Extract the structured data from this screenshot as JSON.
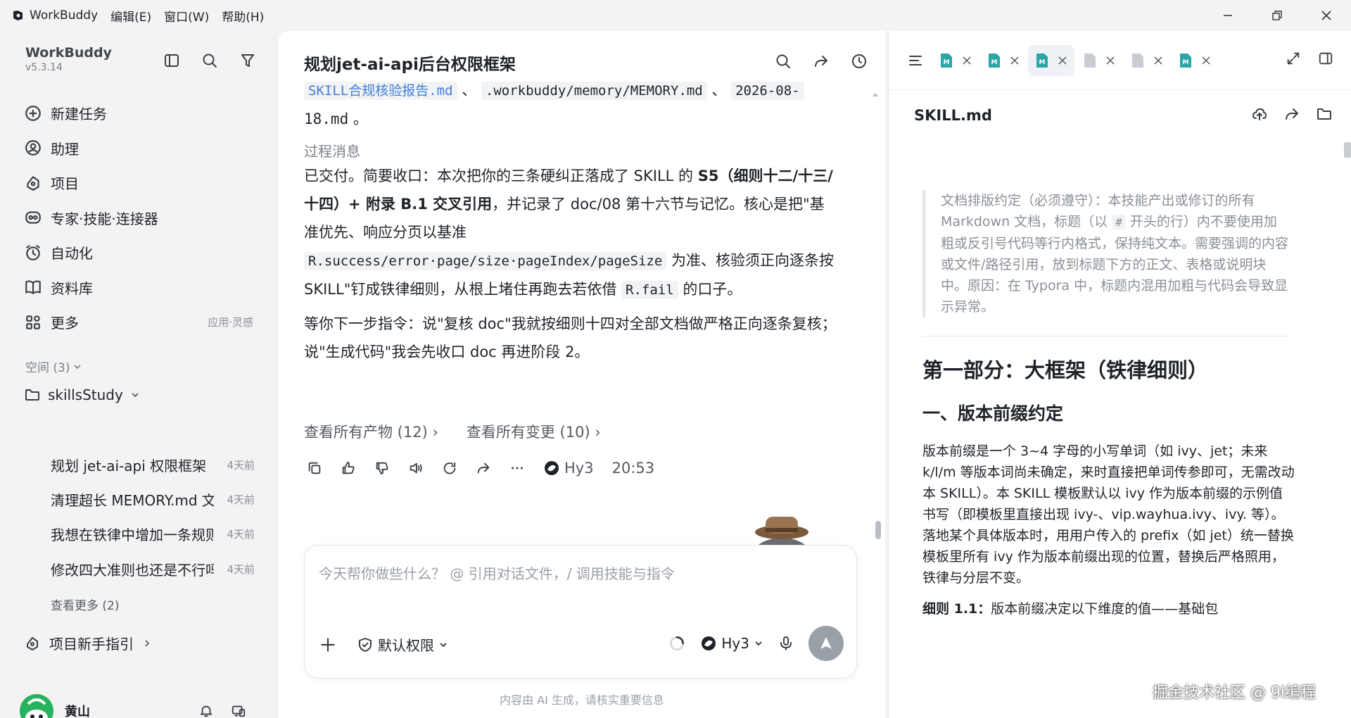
{
  "titlebar": {
    "app_name": "WorkBuddy",
    "menus": [
      "编辑(E)",
      "窗口(W)",
      "帮助(H)"
    ]
  },
  "sidebar": {
    "brand": "WorkBuddy",
    "version": "v5.3.14",
    "nav": [
      {
        "label": "新建任务",
        "icon": "plus-circle-icon"
      },
      {
        "label": "助理",
        "icon": "assistant-icon"
      },
      {
        "label": "项目",
        "icon": "project-icon"
      },
      {
        "label": "专家·技能·连接器",
        "icon": "expert-icon"
      },
      {
        "label": "自动化",
        "icon": "alarm-clock-icon"
      },
      {
        "label": "资料库",
        "icon": "book-icon"
      },
      {
        "label": "更多",
        "icon": "grid-icon"
      }
    ],
    "more_hint": "应用·灵感",
    "space_label": "空间 (3)",
    "folder": "skillsStudy",
    "tasks": [
      {
        "title": "规划 jet-ai-api 权限框架",
        "ago": "4天前"
      },
      {
        "title": "清理超长 MEMORY.md 文件",
        "ago": "4天前"
      },
      {
        "title": "我想在铁律中增加一条规则",
        "ago": "4天前"
      },
      {
        "title": "修改四大准则也还是不行吗",
        "ago": "4天前"
      }
    ],
    "see_more": "查看更多 (2)",
    "guide": "项目新手指引",
    "user_name": "黄山"
  },
  "chat": {
    "title": "规划jet-ai-api后台权限框架",
    "files_line_a": "SKILL合规核验报告.md",
    "files_line_b": ".workbuddy/memory/MEMORY.md",
    "files_line_c": "2026-08-",
    "files_line_d": "18.md",
    "process_label": "过程消息",
    "msg1_a": "已交付。简要收口：本次把你的三条硬纠正落成了 SKILL 的 ",
    "msg1_b": "S5（细则十二/十三/十四）+ 附录 B.1 交叉引用",
    "msg1_c": "，并记录了 doc/08 第十六节与记忆。核心是把\"基准优先、响应分页以基准",
    "msg1_code": "R.success/error·page/size·pageIndex/pageSize",
    "msg1_d": " 为准、核验须正向逐条按 SKILL\"钉成铁律细则，从根上堵住再跑去若依借 ",
    "msg1_code2": "R.fail",
    "msg1_e": " 的口子。",
    "msg2": "等你下一步指令：说\"复核 doc\"我就按细则十四对全部文档做严格正向逐条复核；说\"生成代码\"我会先收口 doc 再进阶段 2。",
    "artifacts": "查看所有产物 (12)",
    "changes": "查看所有变更 (10)",
    "model": "Hy3",
    "time": "20:53",
    "composer_placeholder": "今天帮你做些什么？ @ 引用对话文件，/ 调用技能与指令",
    "permission": "默认权限",
    "composer_model": "Hy3",
    "disclaimer": "内容由 AI 生成，请核实重要信息"
  },
  "doc": {
    "file_name": "SKILL.md",
    "quote_a": "文档排版约定（必须遵守）：本技能产出或修订的所有 Markdown 文档，标题（以 ",
    "quote_code": "#",
    "quote_b": " 开头的行）内不要使用加粗或反引号代码等行内格式，保持纯文本。需要强调的内容或文件/路径引用，放到标题下方的正文、表格或说明块中。原因：在 Typora 中，标题内混用加粗与代码会导致显示异常。",
    "h1": "第一部分：大框架（铁律细则）",
    "h2": "一、版本前缀约定",
    "p": "版本前缀是一个 3~4 字母的小写单词（如 ivy、jet；未来 k/l/m 等版本词尚未确定，来时直接把单词传参即可，无需改动本 SKILL）。本 SKILL 模板默认以 ivy 作为版本前缀的示例值书写（即模板里直接出现 ivy-、vip.wayhua.ivy、ivy. 等）。落地某个具体版本时，用用户传入的 prefix（如 jet）统一替换模板里所有 ivy 作为版本前缀出现的位置，替换后严格照用，铁律与分层不变。",
    "rule_label": "细则 1.1：",
    "rule_text": "版本前缀决定以下维度的值——基础包"
  },
  "watermark": "掘金技术社区 @ 9i编程"
}
